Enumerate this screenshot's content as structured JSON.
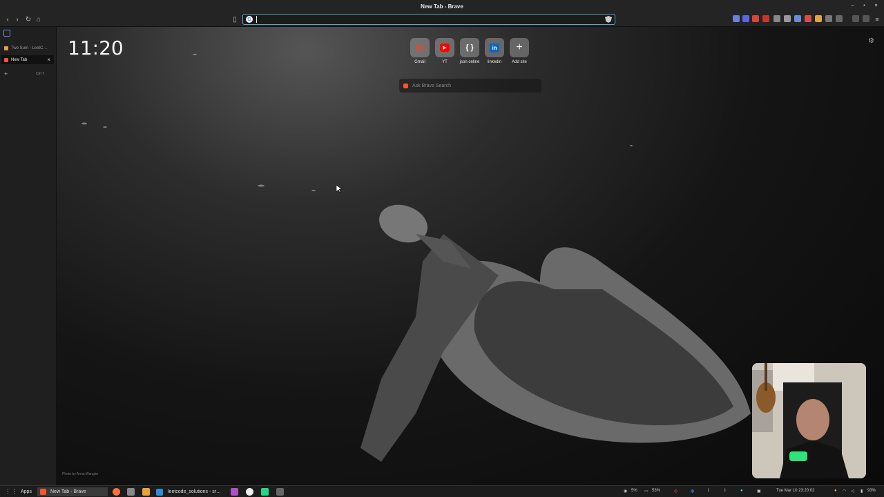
{
  "window": {
    "title": "New Tab - Brave",
    "controls": [
      "–",
      "•",
      "×"
    ]
  },
  "toolbar": {
    "url_value": "",
    "url_placeholder": ""
  },
  "sidebar": {
    "tabs": [
      {
        "label": "Two Sum - LeetC…",
        "active": false
      },
      {
        "label": "New Tab",
        "active": true,
        "close": "×"
      }
    ],
    "new_tab": {
      "plus": "+",
      "shortcut": "Ctrl T"
    }
  },
  "newtab": {
    "clock": "11:20",
    "top_sites": [
      {
        "label": "Gmail",
        "icon": "gmail-icon",
        "glyph": "M"
      },
      {
        "label": "YT",
        "icon": "youtube-icon",
        "glyph": "▶"
      },
      {
        "label": "json online",
        "icon": "json-icon",
        "glyph": "{ }"
      },
      {
        "label": "linkedin",
        "icon": "linkedin-icon",
        "glyph": "in"
      },
      {
        "label": "Add site",
        "icon": "plus-icon",
        "glyph": "+"
      }
    ],
    "search_placeholder": "Ask Brave Search",
    "photo_credit": "Photo by Anna Wangler"
  },
  "taskbar": {
    "apps_label": "Apps",
    "task_brave": "New Tab - Brave",
    "task_vscode": "leetcode_solutions - sr…",
    "cpu": "5%",
    "mem": "53%",
    "datetime": "Tue Mar 10 23:20:02",
    "battery": "93%"
  },
  "colors": {
    "accent": "#5aa9c2",
    "brave": "#fb542b",
    "youtube": "#ff0000",
    "linkedin": "#0a66c2"
  }
}
